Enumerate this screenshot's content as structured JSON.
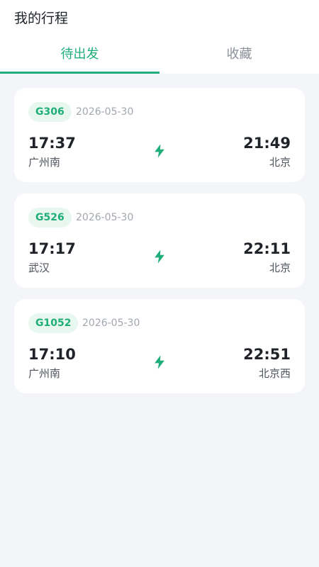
{
  "header": {
    "title": "我的行程"
  },
  "tabs": [
    {
      "label": "待出发",
      "active": true
    },
    {
      "label": "收藏",
      "active": false
    }
  ],
  "trips": [
    {
      "train": "G306",
      "date": "2026-05-30",
      "dep_time": "17:37",
      "dep_station": "广州南",
      "arr_time": "21:49",
      "arr_station": "北京"
    },
    {
      "train": "G526",
      "date": "2026-05-30",
      "dep_time": "17:17",
      "dep_station": "武汉",
      "arr_time": "22:11",
      "arr_station": "北京"
    },
    {
      "train": "G1052",
      "date": "2026-05-30",
      "dep_time": "17:10",
      "dep_station": "广州南",
      "arr_time": "22:51",
      "arr_station": "北京西"
    }
  ],
  "icons": {
    "trip": "lightning-bolt-icon"
  },
  "colors": {
    "accent": "#1fae7a",
    "badge_bg": "#e8f7f0",
    "background": "#f4f5f9"
  }
}
